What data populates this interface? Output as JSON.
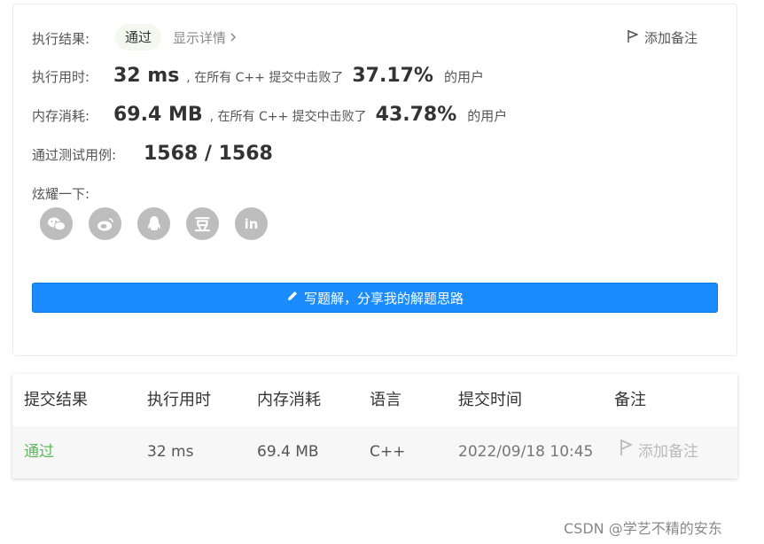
{
  "result": {
    "label": "执行结果:",
    "status": "通过",
    "detail_link": "显示详情",
    "add_note": "添加备注"
  },
  "runtime": {
    "label": "执行用时:",
    "value": "32 ms",
    "middle": ", 在所有 C++ 提交中击败了",
    "percent": "37.17%",
    "suffix": "的用户"
  },
  "memory": {
    "label": "内存消耗:",
    "value": "69.4 MB",
    "middle": ", 在所有 C++ 提交中击败了",
    "percent": "43.78%",
    "suffix": "的用户"
  },
  "testcases": {
    "label": "通过测试用例:",
    "value": "1568 / 1568"
  },
  "share": {
    "label": "炫耀一下:",
    "icons": [
      "wechat-icon",
      "weibo-icon",
      "qq-icon",
      "douban-icon",
      "linkedin-icon"
    ],
    "douban_glyph": "豆",
    "linkedin_glyph": "in"
  },
  "write_button": "写题解，分享我的解题思路",
  "table": {
    "headers": [
      "提交结果",
      "执行用时",
      "内存消耗",
      "语言",
      "提交时间",
      "备注"
    ],
    "rows": [
      {
        "result": "通过",
        "runtime": "32 ms",
        "memory": "69.4 MB",
        "language": "C++",
        "time": "2022/09/18 10:45",
        "note": "添加备注"
      }
    ]
  },
  "watermark": "CSDN @学艺不精的安东",
  "colors": {
    "accent": "#1a8cff",
    "pass_green": "#5cb85c",
    "icon_grey": "#bdbdbd"
  }
}
